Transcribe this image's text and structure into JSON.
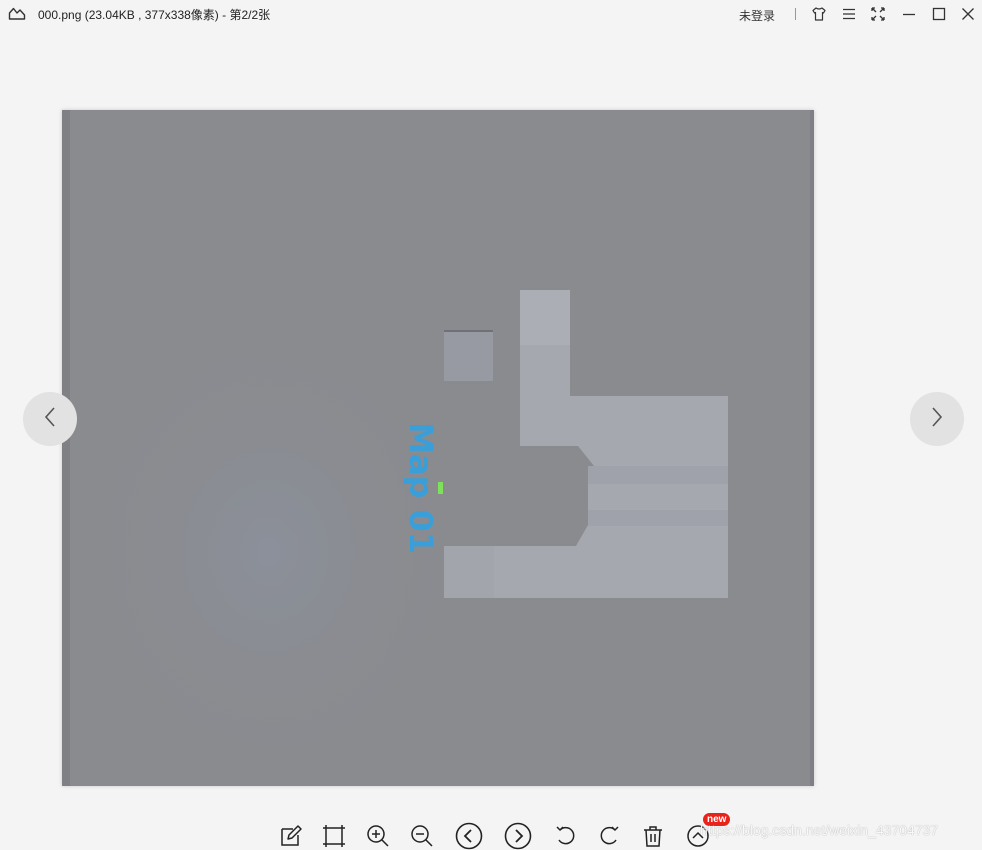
{
  "window": {
    "title": "000.png (23.04KB , 377x338像素) - 第2/2张",
    "login_label": "未登录"
  },
  "image": {
    "map_label": "Map 01",
    "background_color": "#8a8b8f",
    "block_color": "#a6a8b0",
    "label_color": "#3a9fd8",
    "marker_color": "#7fe05a"
  },
  "titlebar_icons": [
    "app-logo-icon",
    "skin-icon",
    "menu-icon",
    "fullscreen-icon",
    "minimize-icon",
    "maximize-icon",
    "close-icon"
  ],
  "toolbar_icons": [
    "edit-icon",
    "crop-icon",
    "zoom-in-icon",
    "zoom-out-icon",
    "prev-circle-icon",
    "next-circle-icon",
    "rotate-left-icon",
    "rotate-right-icon",
    "trash-icon",
    "more-up-icon"
  ],
  "toolbar": {
    "new_badge": "new"
  },
  "watermark": "https://blog.csdn.net/weixin_43704737"
}
